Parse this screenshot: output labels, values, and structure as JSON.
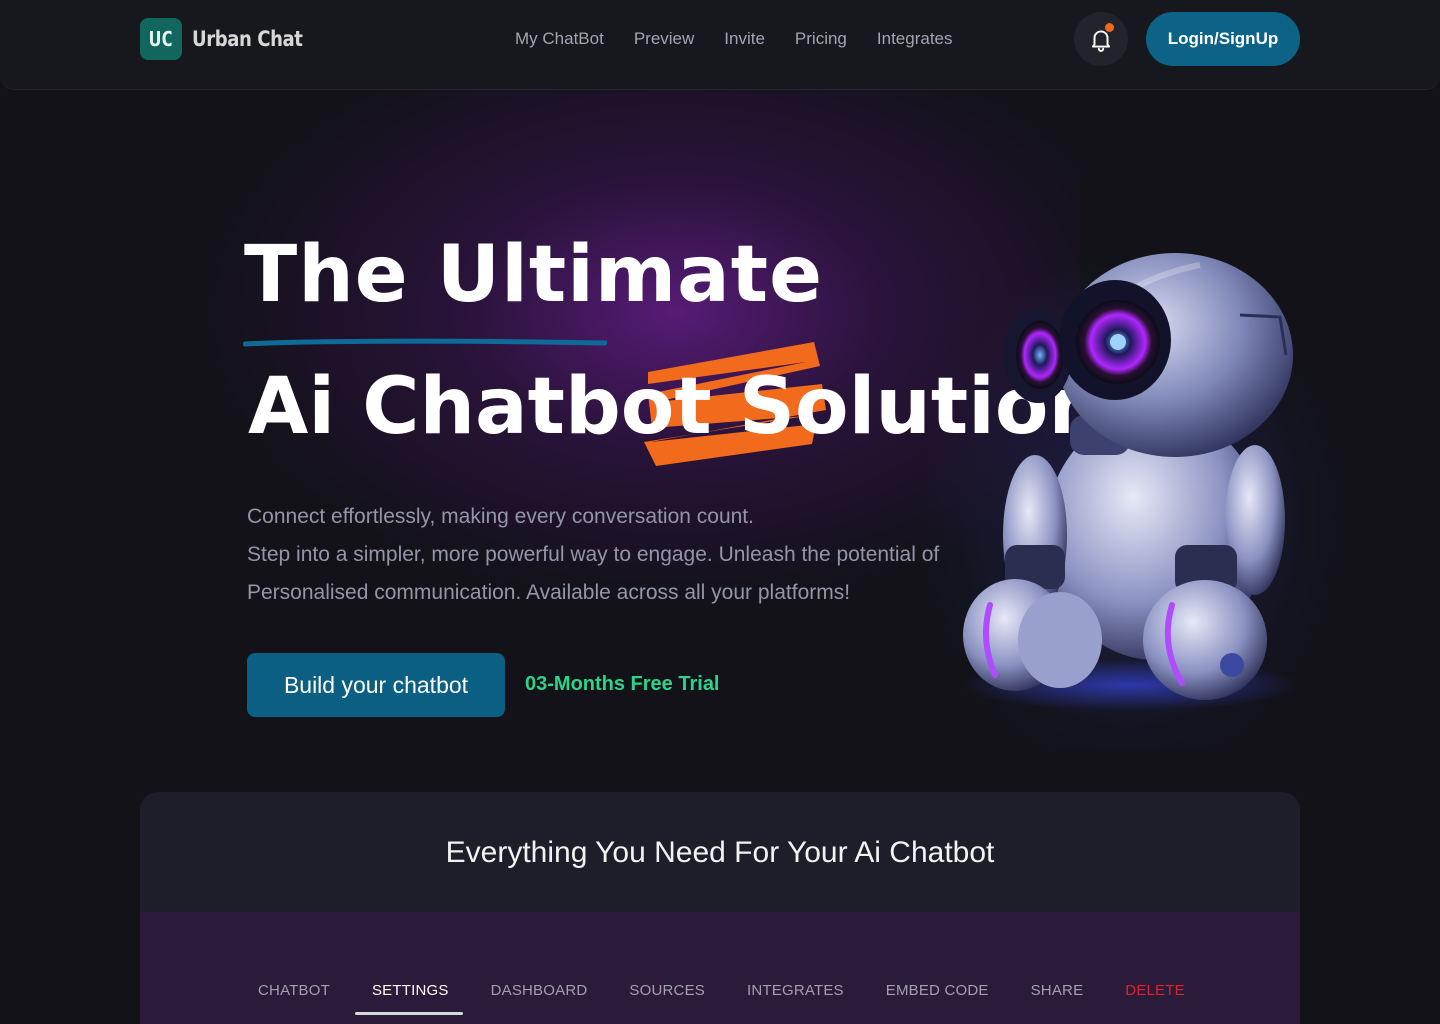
{
  "header": {
    "logo_mark": "UC",
    "logo_text": "Urban Chat",
    "nav": [
      "My ChatBot",
      "Preview",
      "Invite",
      "Pricing",
      "Integrates"
    ],
    "login_label": "Login/SignUp"
  },
  "hero": {
    "title_line1": "The Ultimate",
    "title_line2": "Ai Chatbot Solution",
    "description": [
      "Connect effortlessly, making every conversation count.",
      "Step into a simpler, more powerful way to engage. Unleash the potential of",
      "Personalised communication. Available across all your platforms!"
    ],
    "cta_label": "Build your chatbot",
    "trial_label": "03-Months Free Trial"
  },
  "features": {
    "title": "Everything You Need For Your Ai Chatbot",
    "tabs": [
      "CHATBOT",
      "SETTINGS",
      "DASHBOARD",
      "SOURCES",
      "INTEGRATES",
      "EMBED CODE",
      "SHARE",
      "DELETE"
    ],
    "active_tab": "SETTINGS"
  },
  "colors": {
    "accent": "#0b5f82",
    "highlight": "#f26a1b",
    "trial_green": "#2bd48a",
    "danger": "#e0222a"
  },
  "icons": [
    "bell-icon",
    "robot-illustration"
  ]
}
